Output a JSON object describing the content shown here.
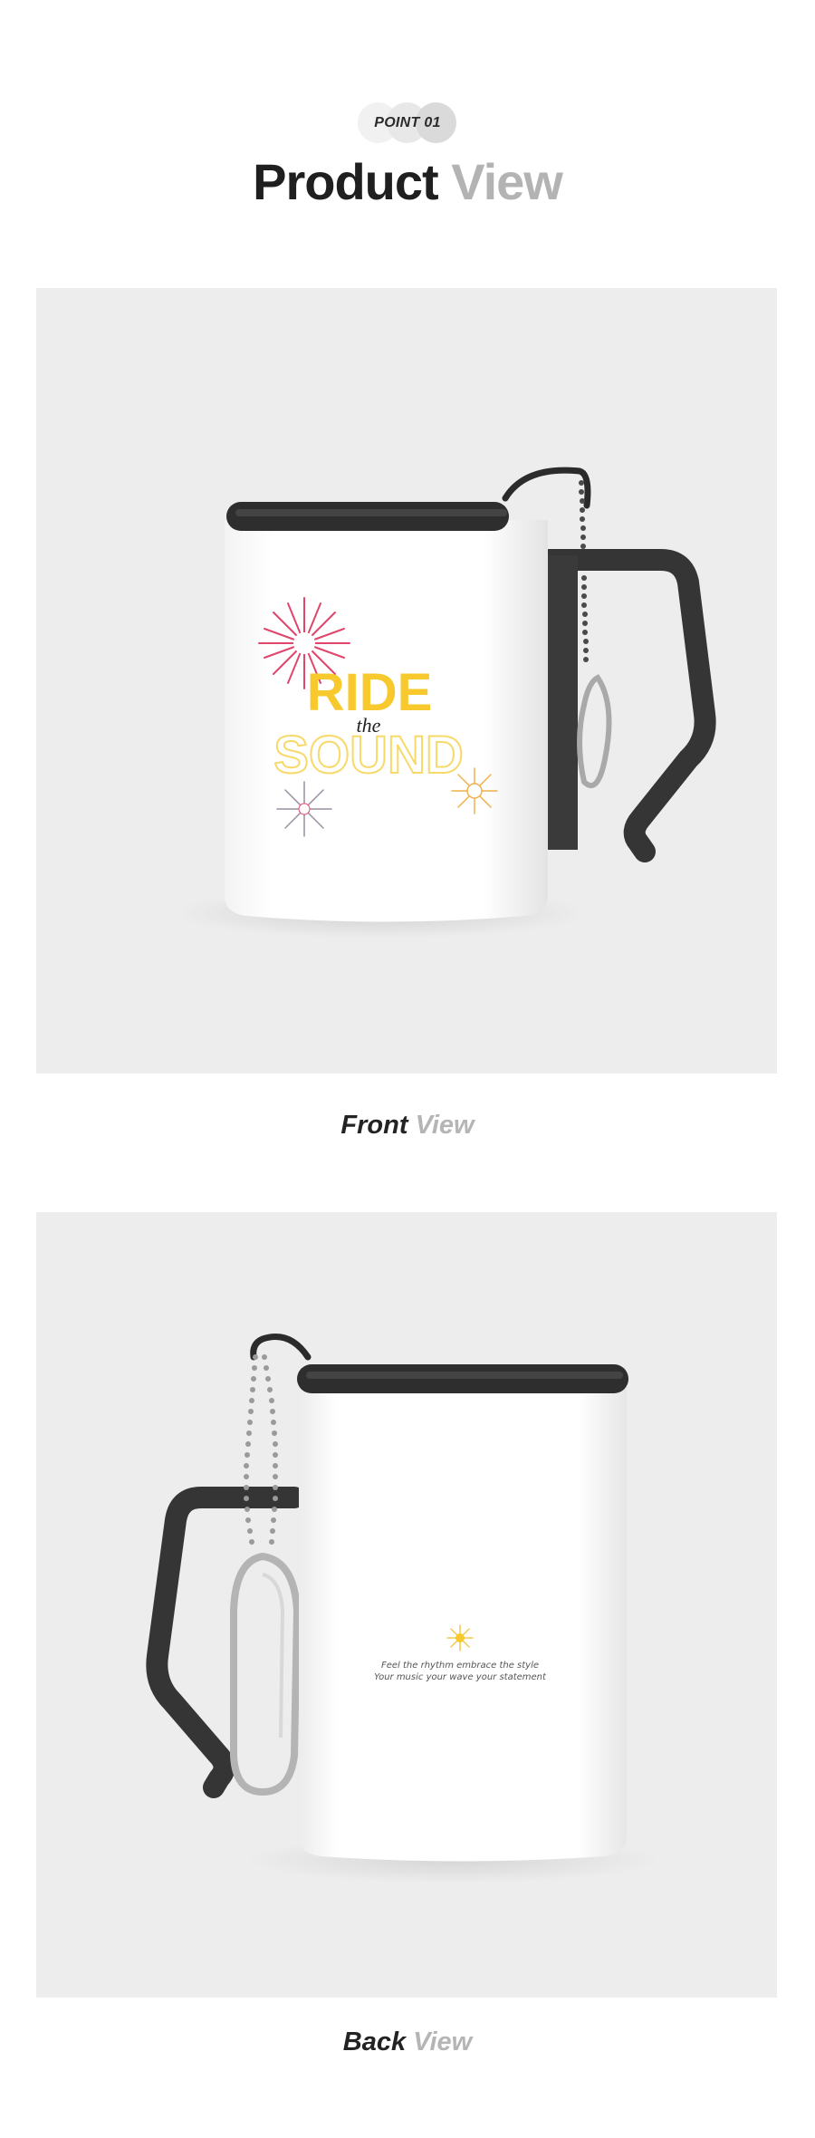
{
  "header": {
    "badge": "POINT 01",
    "title_main": "Product",
    "title_accent": "View"
  },
  "front": {
    "caption_main": "Front",
    "caption_accent": "View",
    "print": {
      "line1": "RIDE",
      "line2": "the",
      "line3": "SOUND"
    }
  },
  "back": {
    "caption_main": "Back",
    "caption_accent": "View",
    "print": {
      "line1": "Feel the rhythm embrace the style",
      "line2": "Your music your wave your statement"
    }
  },
  "colors": {
    "background": "#ededed",
    "lid": "#2e2e2e",
    "handle": "#3a3a3a",
    "accent_yellow": "#f7c92c",
    "accent_pink": "#e0456c"
  }
}
